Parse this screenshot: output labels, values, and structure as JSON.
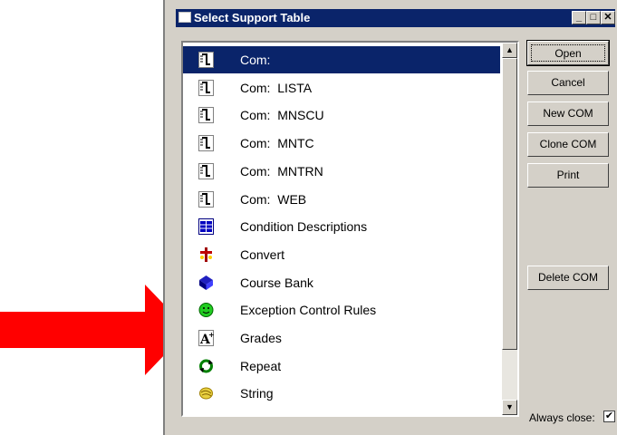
{
  "window": {
    "title": "Select Support Table"
  },
  "title_buttons": {
    "minimize": "_",
    "maximize": "□",
    "close": "✕"
  },
  "list": {
    "items": [
      {
        "label": "Com:",
        "icon": "document-icon",
        "selected": true
      },
      {
        "label": "Com:  LISTA",
        "icon": "document-icon"
      },
      {
        "label": "Com:  MNSCU",
        "icon": "document-icon"
      },
      {
        "label": "Com:  MNTC",
        "icon": "document-icon"
      },
      {
        "label": "Com:  MNTRN",
        "icon": "document-icon"
      },
      {
        "label": "Com:  WEB",
        "icon": "document-icon"
      },
      {
        "label": "Condition Descriptions",
        "icon": "table-icon"
      },
      {
        "label": "Convert",
        "icon": "convert-icon"
      },
      {
        "label": "Course Bank",
        "icon": "book-icon"
      },
      {
        "label": "Exception Control Rules",
        "icon": "smiley-icon"
      },
      {
        "label": "Grades",
        "icon": "grades-icon"
      },
      {
        "label": "Repeat",
        "icon": "repeat-icon"
      },
      {
        "label": "String",
        "icon": "string-icon"
      }
    ]
  },
  "buttons": {
    "open": "Open",
    "cancel": "Cancel",
    "new_com": "New COM",
    "clone_com": "Clone COM",
    "print": "Print",
    "delete_com": "Delete COM"
  },
  "always_close": {
    "label": "Always close:",
    "checked": true
  },
  "colors": {
    "titlebar": "#0a246a",
    "selection": "#0a246a",
    "arrow": "#ff0000",
    "dialog": "#d4d0c8"
  }
}
